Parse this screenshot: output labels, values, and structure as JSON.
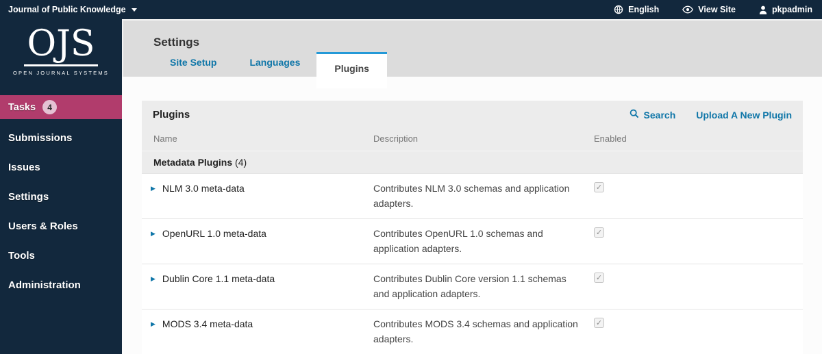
{
  "topbar": {
    "context_title": "Journal of Public Knowledge",
    "nav": [
      {
        "label": "English",
        "icon": "globe-icon"
      },
      {
        "label": "View Site",
        "icon": "eye-icon"
      },
      {
        "label": "pkpadmin",
        "icon": "user-icon"
      }
    ]
  },
  "sidebar": {
    "logo": {
      "acronym": "OJS",
      "caption": "OPEN JOURNAL SYSTEMS"
    },
    "tasks": {
      "label": "Tasks",
      "count": "4"
    },
    "items": [
      {
        "label": "Submissions"
      },
      {
        "label": "Issues"
      },
      {
        "label": "Settings"
      },
      {
        "label": "Users & Roles"
      },
      {
        "label": "Tools"
      },
      {
        "label": "Administration"
      }
    ]
  },
  "main": {
    "title": "Settings",
    "tabs": [
      {
        "label": "Site Setup",
        "active": false
      },
      {
        "label": "Languages",
        "active": false
      },
      {
        "label": "Plugins",
        "active": true
      }
    ],
    "panel": {
      "title": "Plugins",
      "actions": {
        "search": "Search",
        "upload": "Upload A New Plugin"
      },
      "columns": [
        "Name",
        "Description",
        "Enabled"
      ],
      "section": {
        "title": "Metadata Plugins",
        "count": "(4)"
      },
      "rows": [
        {
          "name": "NLM 3.0 meta-data",
          "description": "Contributes NLM 3.0 schemas and application adapters.",
          "enabled": true
        },
        {
          "name": "OpenURL 1.0 meta-data",
          "description": "Contributes OpenURL 1.0 schemas and application adapters.",
          "enabled": true
        },
        {
          "name": "Dublin Core 1.1 meta-data",
          "description": "Contributes Dublin Core version 1.1 schemas and application adapters.",
          "enabled": true
        },
        {
          "name": "MODS 3.4 meta-data",
          "description": "Contributes MODS 3.4 schemas and application adapters.",
          "enabled": true
        }
      ]
    }
  },
  "colors": {
    "navy": "#12283d",
    "pink": "#b13c6c",
    "badge_bg": "#e5c1d3",
    "link_blue": "#0f76a8",
    "tab_accent": "#2499d7",
    "header_gray": "#dcdcdc",
    "panel_gray": "#ececec"
  }
}
